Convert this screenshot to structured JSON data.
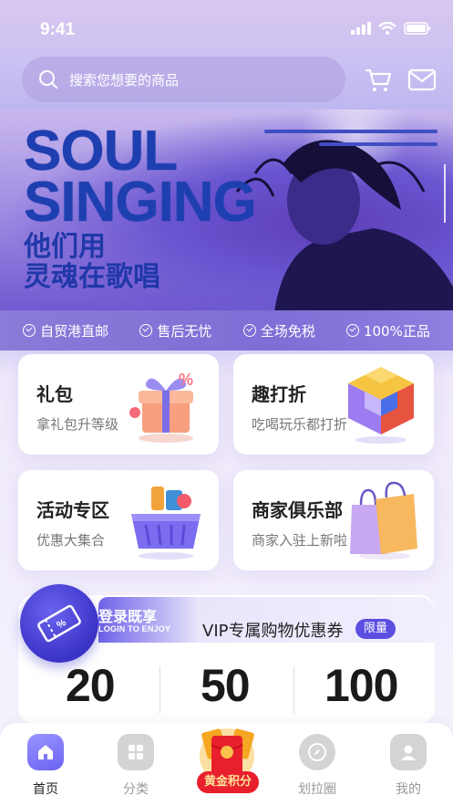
{
  "status_bar": {
    "time": "9:41"
  },
  "search": {
    "placeholder": "搜索您想要的商品"
  },
  "hero": {
    "title_line1": "SOUL",
    "title_line2": "SINGING",
    "subtitle_line1": "他们用",
    "subtitle_line2": "灵魂在歌唱"
  },
  "features": [
    "自贸港直邮",
    "售后无忧",
    "全场免税",
    "100%正品"
  ],
  "cards": [
    {
      "title": "礼包",
      "subtitle": "拿礼包升等级",
      "icon": "gift-icon"
    },
    {
      "title": "趣打折",
      "subtitle": "吃喝玩乐都打折",
      "icon": "cube-icon"
    },
    {
      "title": "活动专区",
      "subtitle": "优惠大集合",
      "icon": "basket-icon"
    },
    {
      "title": "商家俱乐部",
      "subtitle": "商家入驻上新啦",
      "icon": "shopping-bags-icon"
    }
  ],
  "coupon": {
    "login_label": "登录既享",
    "login_en": "LOGIN TO ENJOY",
    "title": "VIP专属购物优惠券",
    "badge": "限量",
    "amounts": [
      "20",
      "50",
      "100"
    ]
  },
  "tabbar": {
    "items": [
      {
        "label": "首页",
        "icon": "home-icon",
        "active": true
      },
      {
        "label": "分类",
        "icon": "grid-icon",
        "active": false
      },
      {
        "label": "划拉圈",
        "icon": "compass-icon",
        "active": false
      },
      {
        "label": "我的",
        "icon": "user-icon",
        "active": false
      }
    ],
    "gold_label": "黄金积分"
  },
  "colors": {
    "accent": "#5b4fe0",
    "hero_text": "#1e3fb0",
    "gold_red": "#e8202d"
  }
}
